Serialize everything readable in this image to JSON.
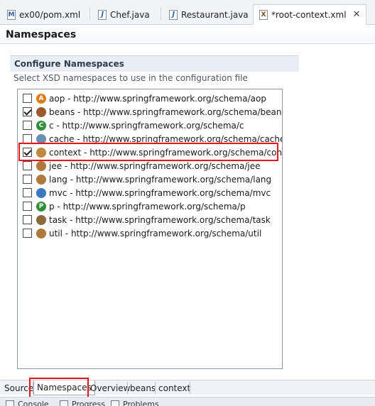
{
  "editor_tabs": [
    {
      "label": "ex00/pom.xml",
      "icon": "maven-file-icon",
      "glyph": "M"
    },
    {
      "label": "Chef.java",
      "icon": "java-file-icon",
      "glyph": "J"
    },
    {
      "label": "Restaurant.java",
      "icon": "java-file-icon",
      "glyph": "J"
    },
    {
      "label": "*root-context.xml",
      "icon": "xml-file-icon",
      "glyph": "X",
      "close": "✕"
    }
  ],
  "page_title": "Namespaces",
  "section": {
    "title": "Configure Namespaces",
    "description": "Select XSD namespaces to use in the configuration file"
  },
  "namespaces": [
    {
      "label": "aop - http://www.springframework.org/schema/aop",
      "checked": false,
      "icon": "aop-icon",
      "glyph": "A",
      "color": "#e07b1a"
    },
    {
      "label": "beans - http://www.springframework.org/schema/beans",
      "checked": true,
      "icon": "beans-icon",
      "glyph": "",
      "color": "#9b5a2a"
    },
    {
      "label": "c - http://www.springframework.org/schema/c",
      "checked": false,
      "icon": "c-icon",
      "glyph": "C",
      "color": "#2f8f3a"
    },
    {
      "label": "cache - http://www.springframework.org/schema/cache",
      "checked": false,
      "icon": "cache-icon",
      "glyph": "",
      "color": "#6a8fb0"
    },
    {
      "label": "context - http://www.springframework.org/schema/context",
      "checked": true,
      "icon": "context-icon",
      "glyph": "",
      "color": "#c08a3e"
    },
    {
      "label": "jee - http://www.springframework.org/schema/jee",
      "checked": false,
      "icon": "jee-icon",
      "glyph": "",
      "color": "#b07a3a"
    },
    {
      "label": "lang - http://www.springframework.org/schema/lang",
      "checked": false,
      "icon": "lang-icon",
      "glyph": "",
      "color": "#b07a3a"
    },
    {
      "label": "mvc - http://www.springframework.org/schema/mvc",
      "checked": false,
      "icon": "mvc-icon",
      "glyph": "",
      "color": "#3a78c2"
    },
    {
      "label": "p - http://www.springframework.org/schema/p",
      "checked": false,
      "icon": "p-icon",
      "glyph": "P",
      "color": "#2f8f3a"
    },
    {
      "label": "task - http://www.springframework.org/schema/task",
      "checked": false,
      "icon": "task-icon",
      "glyph": "",
      "color": "#8a6a3a"
    },
    {
      "label": "util - http://www.springframework.org/schema/util",
      "checked": false,
      "icon": "util-icon",
      "glyph": "",
      "color": "#b07a3a"
    }
  ],
  "page_tabs": [
    "Source",
    "Namespaces",
    "Overview",
    "beans",
    "context"
  ],
  "active_page_tab": "Namespaces",
  "view_tabs": [
    {
      "label": "Console",
      "icon": "console-icon"
    },
    {
      "label": "Progress",
      "icon": "progress-icon"
    },
    {
      "label": "Problems",
      "icon": "problems-icon"
    }
  ],
  "colors": {
    "highlight": "#e8141b"
  }
}
